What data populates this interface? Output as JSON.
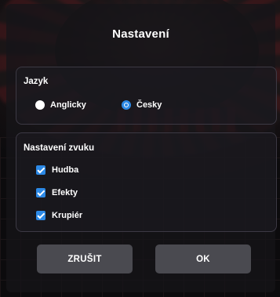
{
  "dialog": {
    "title": "Nastavení"
  },
  "language": {
    "heading": "Jazyk",
    "options": [
      {
        "label": "Anglicky",
        "selected": false
      },
      {
        "label": "Česky",
        "selected": true
      }
    ]
  },
  "sound": {
    "heading": "Nastavení zvuku",
    "options": [
      {
        "label": "Hudba",
        "checked": true
      },
      {
        "label": "Efekty",
        "checked": true
      },
      {
        "label": "Krupiér",
        "checked": true
      }
    ]
  },
  "buttons": {
    "cancel_label": "ZRUŠIT",
    "ok_label": "OK"
  },
  "colors": {
    "accent": "#2c89e6",
    "button_bg": "#4a4a50",
    "panel_border": "#3c3944"
  }
}
